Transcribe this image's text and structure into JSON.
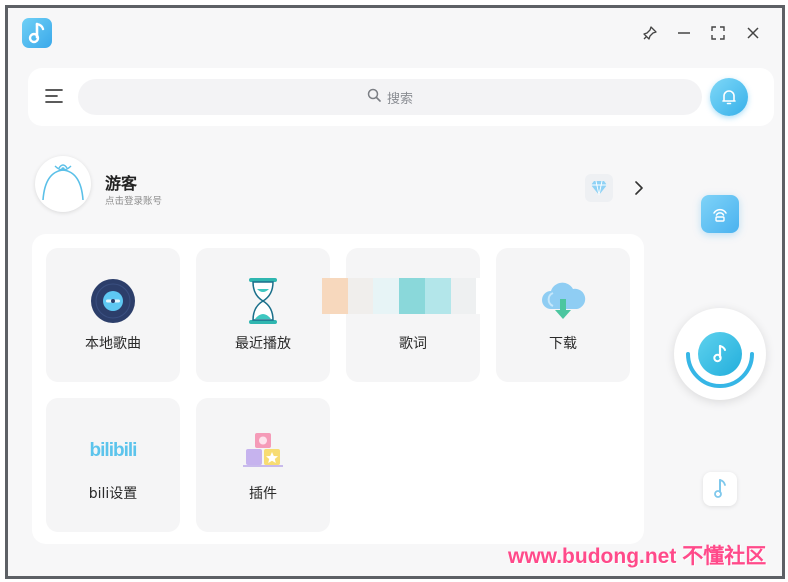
{
  "window": {
    "logo_icon": "music-note-icon",
    "controls": [
      "pin-icon",
      "minimize-icon",
      "fullscreen-icon",
      "close-icon"
    ]
  },
  "search": {
    "placeholder": "搜索"
  },
  "user": {
    "name": "游客",
    "hint": "点击登录账号"
  },
  "tiles": [
    {
      "label": "本地歌曲",
      "icon": "vinyl-disc-icon"
    },
    {
      "label": "最近播放",
      "icon": "hourglass-icon"
    },
    {
      "label": "歌词",
      "icon": "lyrics-icon"
    },
    {
      "label": "下载",
      "icon": "cloud-download-icon"
    },
    {
      "label": "bili设置",
      "icon": "bilibili-icon"
    },
    {
      "label": "插件",
      "icon": "plugin-blocks-icon"
    }
  ],
  "bilibili_logo_text": "bilibili",
  "watermark": "www.budong.net 不懂社区",
  "colors": {
    "accent": "#36b0ea",
    "accent_light": "#7fd8f7",
    "watermark": "#ff4a8a"
  }
}
